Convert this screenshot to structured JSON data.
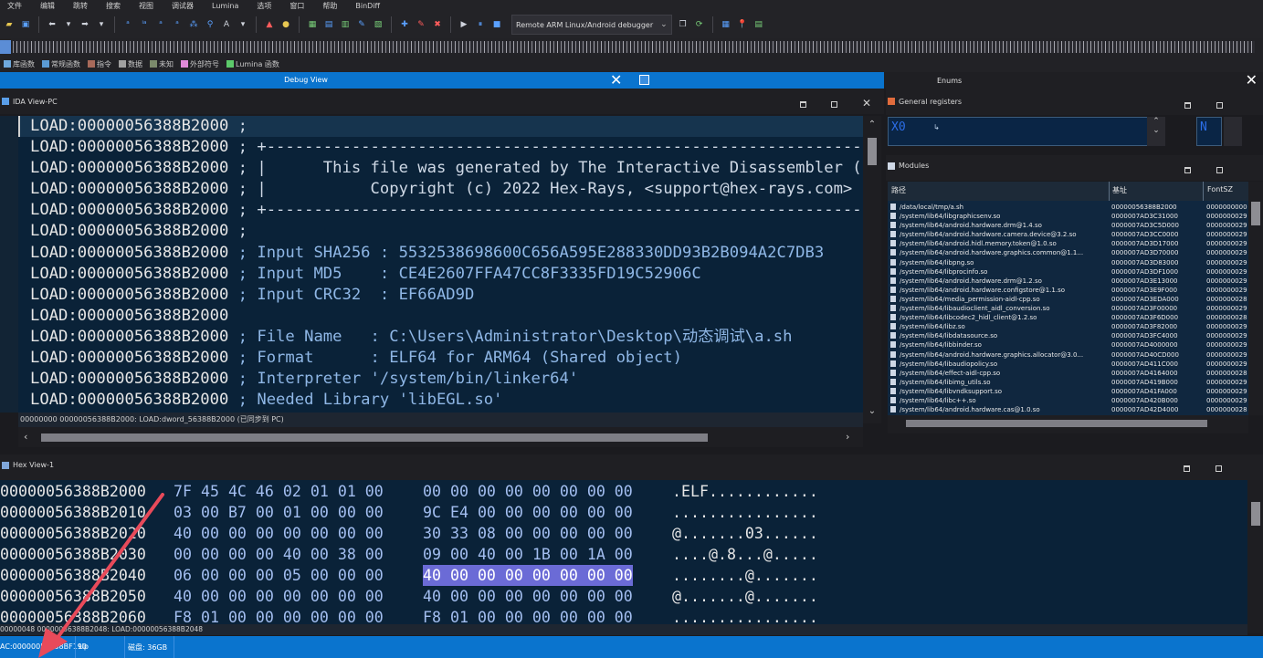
{
  "menu": [
    "文件",
    "编辑",
    "跳转",
    "搜索",
    "视图",
    "调试器",
    "Lumina",
    "选项",
    "窗口",
    "帮助",
    "BinDiff"
  ],
  "toolbar": {
    "debugger_select": "Remote ARM Linux/Android debugger"
  },
  "legend": [
    {
      "label": "库函数",
      "color": "#6fa8dc"
    },
    {
      "label": "常规函数",
      "color": "#5b9bd5"
    },
    {
      "label": "指令",
      "color": "#a86a5a"
    },
    {
      "label": "数据",
      "color": "#a0a0a0"
    },
    {
      "label": "未知",
      "color": "#7b8a6b"
    },
    {
      "label": "外部符号",
      "color": "#e08ad8"
    },
    {
      "label": "Lumina 函数",
      "color": "#5cc96a"
    }
  ],
  "debug_view": {
    "title": "Debug View"
  },
  "enums": {
    "title": "Enums"
  },
  "ida_view": {
    "title": "IDA View-PC",
    "status": "00000000 00000056388B2000: LOAD:dword_56388B2000 (已同步到 PC)",
    "lines": [
      {
        "seg": "LOAD:00000056388B2000",
        "text": " ;"
      },
      {
        "seg": "LOAD:00000056388B2000",
        "text": " ; +-------------------------------------------------------------------------"
      },
      {
        "seg": "LOAD:00000056388B2000",
        "text": " ; |      This file was generated by The Interactive Disassembler (IDA)"
      },
      {
        "seg": "LOAD:00000056388B2000",
        "text": " ; |           Copyright (c) 2022 Hex-Rays, <support@hex-rays.com>"
      },
      {
        "seg": "LOAD:00000056388B2000",
        "text": " ; +-------------------------------------------------------------------------"
      },
      {
        "seg": "LOAD:00000056388B2000",
        "text": " ;"
      },
      {
        "seg": "LOAD:00000056388B2000",
        "text": " ; Input SHA256 : 5532538698600C656A595E288330DD93B2B094A2C7DB3"
      },
      {
        "seg": "LOAD:00000056388B2000",
        "text": " ; Input MD5    : CE4E2607FFA47CC8F3335FD19C52906C"
      },
      {
        "seg": "LOAD:00000056388B2000",
        "text": " ; Input CRC32  : EF66AD9D"
      },
      {
        "seg": "LOAD:00000056388B2000",
        "text": ""
      },
      {
        "seg": "LOAD:00000056388B2000",
        "text": " ; File Name   : C:\\Users\\Administrator\\Desktop\\动态调试\\a.sh"
      },
      {
        "seg": "LOAD:00000056388B2000",
        "text": " ; Format      : ELF64 for ARM64 (Shared object)"
      },
      {
        "seg": "LOAD:00000056388B2000",
        "text": " ; Interpreter '/system/bin/linker64'"
      },
      {
        "seg": "LOAD:00000056388B2000",
        "text": " ; Needed Library 'libEGL.so'"
      }
    ]
  },
  "registers": {
    "title": "General registers",
    "reg": "X0",
    "value": "↳",
    "flag": "N"
  },
  "modules": {
    "title": "Modules",
    "columns": [
      "路径",
      "基址",
      "FontSZ"
    ],
    "rows": [
      {
        "path": "/data/local/tmp/a.sh",
        "base": "00000056388B2000",
        "size": "0000000000"
      },
      {
        "path": "/system/lib64/libgraphicsenv.so",
        "base": "0000007AD3C31000",
        "size": "0000000029"
      },
      {
        "path": "/system/lib64/android.hardware.drm@1.4.so",
        "base": "0000007AD3C5D000",
        "size": "0000000029"
      },
      {
        "path": "/system/lib64/android.hardware.camera.device@3.2.so",
        "base": "0000007AD3CC0000",
        "size": "0000000029"
      },
      {
        "path": "/system/lib64/android.hidl.memory.token@1.0.so",
        "base": "0000007AD3D17000",
        "size": "0000000029"
      },
      {
        "path": "/system/lib64/android.hardware.graphics.common@1.1...",
        "base": "0000007AD3D70000",
        "size": "0000000029"
      },
      {
        "path": "/system/lib64/libpng.so",
        "base": "0000007AD3D83000",
        "size": "0000000029"
      },
      {
        "path": "/system/lib64/libprocinfo.so",
        "base": "0000007AD3DF1000",
        "size": "0000000029"
      },
      {
        "path": "/system/lib64/android.hardware.drm@1.2.so",
        "base": "0000007AD3E13000",
        "size": "0000000029"
      },
      {
        "path": "/system/lib64/android.hardware.configstore@1.1.so",
        "base": "0000007AD3E9F000",
        "size": "0000000029"
      },
      {
        "path": "/system/lib64/media_permission-aidl-cpp.so",
        "base": "0000007AD3EDA000",
        "size": "0000000028"
      },
      {
        "path": "/system/lib64/libaudioclient_aidl_conversion.so",
        "base": "0000007AD3F00000",
        "size": "0000000029"
      },
      {
        "path": "/system/lib64/libcodec2_hidl_client@1.2.so",
        "base": "0000007AD3F6D000",
        "size": "0000000028"
      },
      {
        "path": "/system/lib64/libz.so",
        "base": "0000007AD3F82000",
        "size": "0000000029"
      },
      {
        "path": "/system/lib64/libdatasource.so",
        "base": "0000007AD3FC4000",
        "size": "0000000029"
      },
      {
        "path": "/system/lib64/libbinder.so",
        "base": "0000007AD4000000",
        "size": "0000000029"
      },
      {
        "path": "/system/lib64/android.hardware.graphics.allocator@3.0...",
        "base": "0000007AD40CD000",
        "size": "0000000029"
      },
      {
        "path": "/system/lib64/libaudiopolicy.so",
        "base": "0000007AD411C000",
        "size": "0000000029"
      },
      {
        "path": "/system/lib64/effect-aidl-cpp.so",
        "base": "0000007AD4164000",
        "size": "0000000028"
      },
      {
        "path": "/system/lib64/libimg_utils.so",
        "base": "0000007AD419B000",
        "size": "0000000029"
      },
      {
        "path": "/system/lib64/libvndksupport.so",
        "base": "0000007AD41FA000",
        "size": "0000000029"
      },
      {
        "path": "/system/lib64/libc++.so",
        "base": "0000007AD420B000",
        "size": "0000000029"
      },
      {
        "path": "/system/lib64/android.hardware.cas@1.0.so",
        "base": "0000007AD42D4000",
        "size": "0000000028"
      }
    ]
  },
  "hex_view": {
    "title": "Hex View-1",
    "status": "00000048 00000056388B2048: LOAD:00000056388B2048",
    "rows": [
      {
        "addr": "00000056388B2000",
        "h1": "7F 45 4C 46 02 01 01 00",
        "h2": "00 00 00 00 00 00 00 00",
        "ascii": ".ELF............",
        "selected": false
      },
      {
        "addr": "00000056388B2010",
        "h1": "03 00 B7 00 01 00 00 00",
        "h2": "9C E4 00 00 00 00 00 00",
        "ascii": "................",
        "selected": false
      },
      {
        "addr": "00000056388B2020",
        "h1": "40 00 00 00 00 00 00 00",
        "h2": "30 33 08 00 00 00 00 00",
        "ascii": "@.......03......",
        "selected": false
      },
      {
        "addr": "00000056388B2030",
        "h1": "00 00 00 00 40 00 38 00",
        "h2": "09 00 40 00 1B 00 1A 00",
        "ascii": "....@.8...@.....",
        "selected": false
      },
      {
        "addr": "00000056388B2040",
        "h1": "06 00 00 00 05 00 00 00",
        "h2": "40 00 00 00 00 00 00 00",
        "ascii": "........@.......",
        "selected": true
      },
      {
        "addr": "00000056388B2050",
        "h1": "40 00 00 00 00 00 00 00",
        "h2": "40 00 00 00 00 00 00 00",
        "ascii": "@.......@.......",
        "selected": false
      },
      {
        "addr": "00000056388B2060",
        "h1": "F8 01 00 00 00 00 00 00",
        "h2": "F8 01 00 00 00 00 00 00",
        "ascii": "................",
        "selected": false
      }
    ]
  },
  "statusbar": {
    "address": "AC:00000056388BF190",
    "state": "Up",
    "disk": "磁盘: 36GB"
  },
  "colors": {
    "accent": "#0a74ce",
    "editor_bg": "#0a2238",
    "hex_selection": "#6b6bd6",
    "arrow": "#e84a5a"
  }
}
